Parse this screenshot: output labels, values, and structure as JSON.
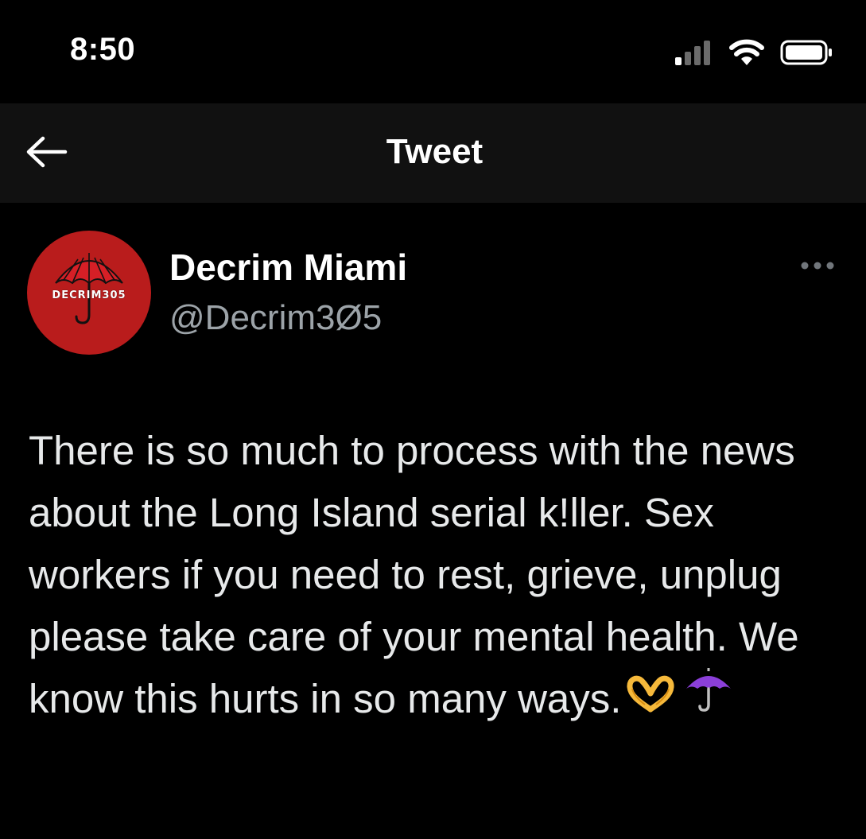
{
  "status_bar": {
    "time": "8:50",
    "signal_icon": "cellular-signal-icon",
    "wifi_icon": "wifi-icon",
    "battery_icon": "battery-icon"
  },
  "nav": {
    "back_icon": "back-arrow-icon",
    "title": "Tweet"
  },
  "tweet": {
    "author": {
      "display_name": "Decrim Miami",
      "handle": "@Decrim3Ø5",
      "avatar_text": "DECRIM305",
      "avatar_icon": "umbrella-icon",
      "avatar_color": "#b91c1c"
    },
    "more_icon": "more-options-icon",
    "text": "There is so much to process with the news about the Long Island serial k!ller. Sex workers if you need to rest, grieve, unplug please take care of your mental health. We know this hurts in so many ways.",
    "emojis": [
      "heart-hands-emoji",
      "purple-umbrella-emoji"
    ]
  },
  "colors": {
    "background": "#000000",
    "nav_background": "#111111",
    "text_primary": "#e7e9ea",
    "text_secondary": "#9ca3a8",
    "umbrella_purple": "#8b3fd9",
    "heart_hands_yellow": "#f6b93b"
  }
}
